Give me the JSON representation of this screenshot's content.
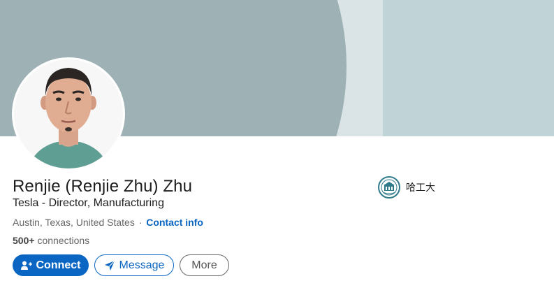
{
  "profile": {
    "name": "Renjie (Renjie Zhu) Zhu",
    "headline": "Tesla - Director, Manufacturing",
    "location": "Austin, Texas, United States",
    "separator": "·",
    "contact_info": "Contact info",
    "connections_count": "500+",
    "connections_label": "connections"
  },
  "actions": {
    "connect": "Connect",
    "message": "Message",
    "more": "More"
  },
  "education": {
    "school": "哈工大",
    "logo_icon": "university-seal-icon"
  },
  "colors": {
    "accent": "#0a66c2",
    "banner_dark": "#9eb1b4",
    "banner_light": "#c0d3d6"
  }
}
